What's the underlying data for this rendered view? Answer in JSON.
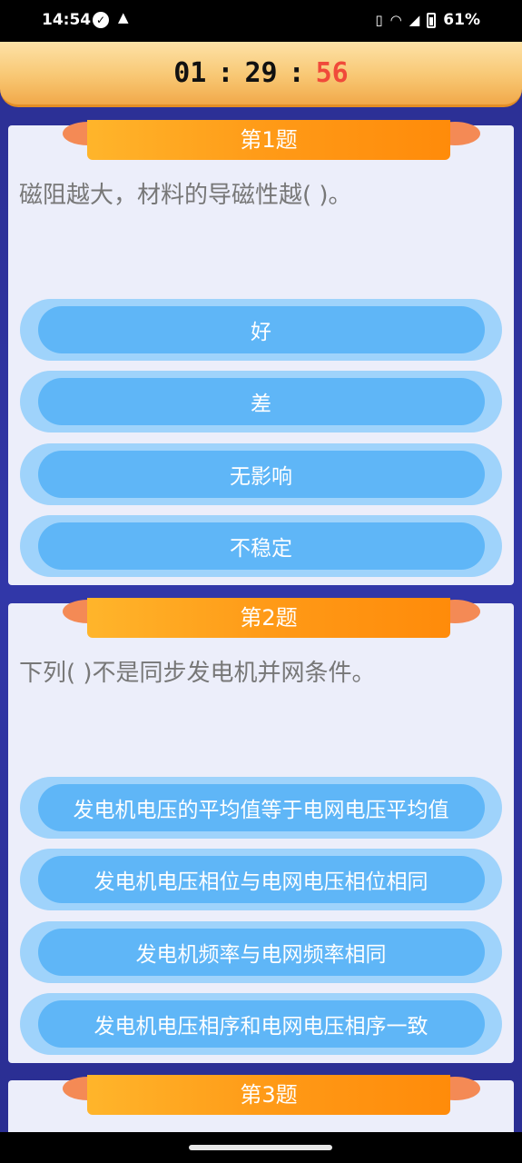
{
  "status": {
    "time": "14:54",
    "battery": "61%"
  },
  "timer": {
    "hours": "01",
    "minutes": "29",
    "seconds": "56",
    "separator": ":"
  },
  "questions": [
    {
      "title": "第1题",
      "text": "磁阻越大，材料的导磁性越( )。",
      "options": [
        "好",
        "差",
        "无影响",
        "不稳定"
      ]
    },
    {
      "title": "第2题",
      "text": "下列( )不是同步发电机并网条件。",
      "options": [
        "发电机电压的平均值等于电网电压平均值",
        "发电机电压相位与电网电压相位相同",
        "发电机频率与电网频率相同",
        "发电机电压相序和电网电压相序一致"
      ]
    },
    {
      "title": "第3题"
    }
  ],
  "colors": {
    "background": "#2f35a3",
    "timer_seconds": "#f04a3a",
    "ribbon": "#ff9a17",
    "option_outer": "#9fd3fb",
    "option_inner": "#5fb6f7",
    "card": "#eceefa"
  }
}
